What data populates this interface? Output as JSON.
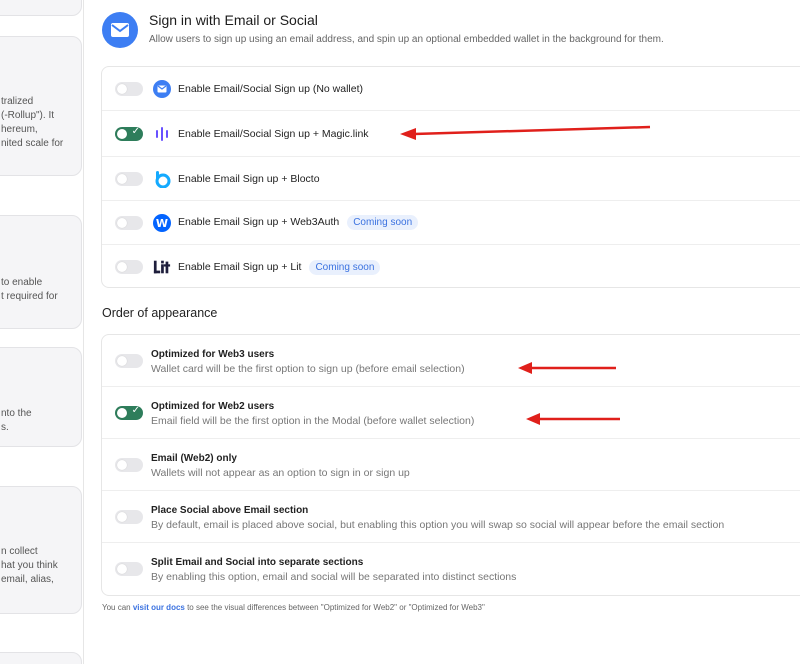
{
  "left_cards": [
    {
      "lines": []
    },
    {
      "lines": [
        "tralized",
        "(-Rollup\"). It",
        "hereum,",
        "nited scale for"
      ]
    },
    {
      "lines": [
        "to enable",
        "t required for"
      ]
    },
    {
      "lines": [
        "nto the",
        "s."
      ]
    },
    {
      "lines": [
        "n collect",
        "hat you think",
        "email, alias,"
      ]
    }
  ],
  "header": {
    "icon": "envelope-icon",
    "title": "Sign in with Email or Social",
    "subtitle": "Allow users to sign up using an email address, and spin up an optional embedded wallet in the background for them."
  },
  "options": [
    {
      "label": "Enable Email/Social Sign up (No wallet)",
      "enabled": false,
      "icon": "email-circle-icon"
    },
    {
      "label": "Enable Email/Social Sign up + Magic.link",
      "enabled": true,
      "icon": "magic-link-icon"
    },
    {
      "label": "Enable Email Sign up + Blocto",
      "enabled": false,
      "icon": "blocto-icon"
    },
    {
      "label": "Enable Email Sign up + Web3Auth",
      "enabled": false,
      "icon": "web3auth-icon",
      "badge": "Coming soon"
    },
    {
      "label": "Enable Email Sign up + Lit",
      "enabled": false,
      "icon": "lit-icon",
      "badge": "Coming soon"
    }
  ],
  "appearance": {
    "title": "Order of appearance",
    "items": [
      {
        "title": "Optimized for Web3 users",
        "desc": "Wallet card will be the first option to sign up (before email selection)",
        "enabled": false
      },
      {
        "title": "Optimized for Web2 users",
        "desc": "Email field will be the first option in the Modal (before wallet selection)",
        "enabled": true
      },
      {
        "title": "Email (Web2) only",
        "desc": "Wallets will not appear as an option to sign in or sign up",
        "enabled": false
      },
      {
        "title": "Place Social above Email section",
        "desc": "By default, email is placed above social, but enabling this option you will swap so social will appear before the email section",
        "enabled": false
      },
      {
        "title": "Split Email and Social into separate sections",
        "desc": "By enabling this option, email and social will be separated into distinct sections",
        "enabled": false
      }
    ]
  },
  "footnote": {
    "prefix": "You can ",
    "link": "visit our docs",
    "suffix": " to see the visual differences between \"Optimized for Web2\" or \"Optimized for Web3\""
  },
  "colors": {
    "accent": "#3d7ef3",
    "toggle_on": "#2e7d5b",
    "arrow": "#e0201b",
    "badge_text": "#3b72e0"
  }
}
